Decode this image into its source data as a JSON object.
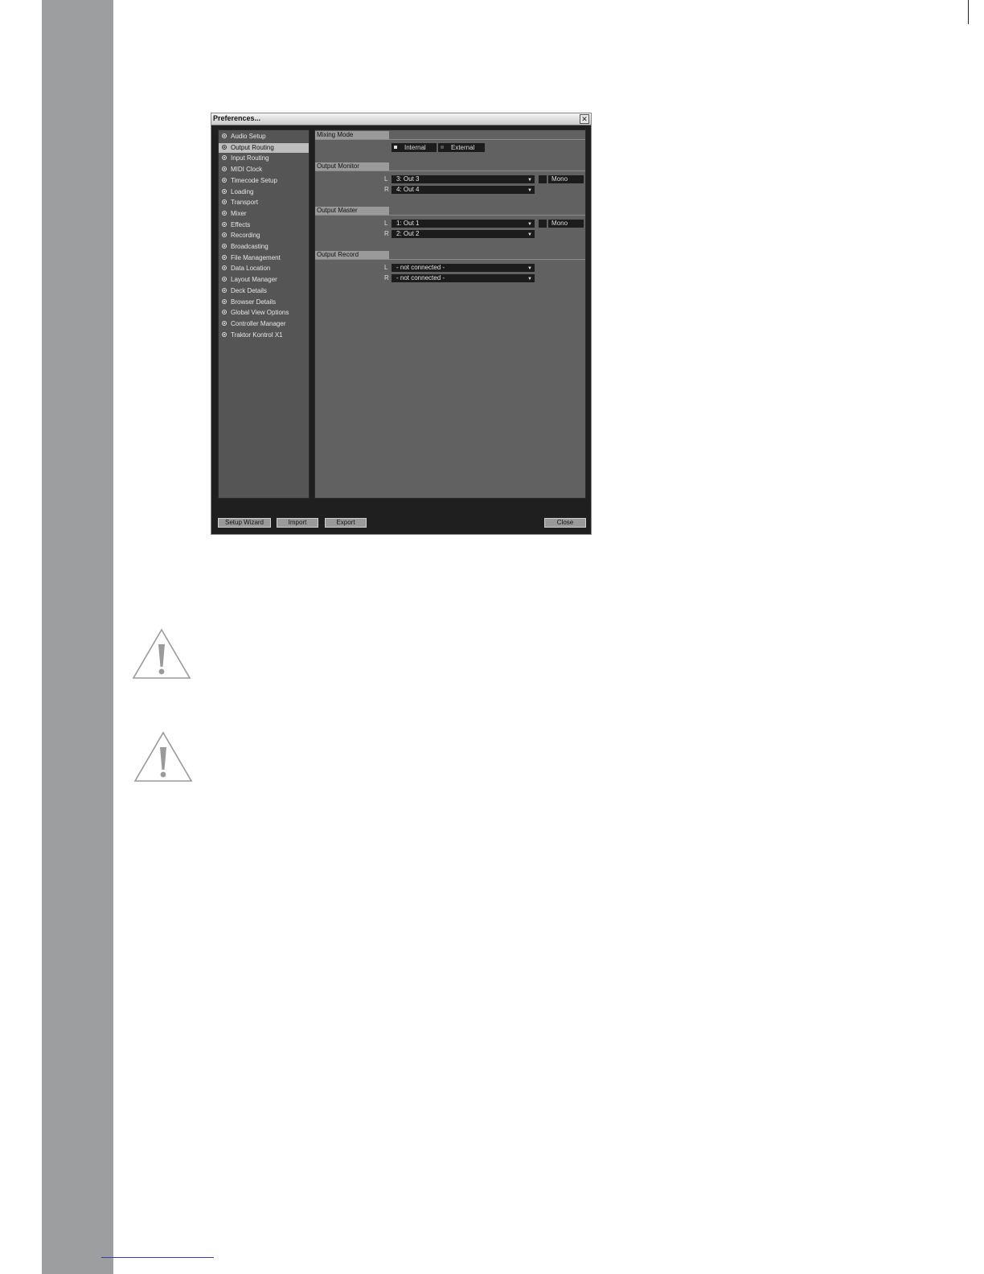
{
  "window": {
    "title": "Preferences...",
    "close_glyph": "✕"
  },
  "sidebar": {
    "items": [
      {
        "label": "Audio Setup",
        "selected": false
      },
      {
        "label": "Output Routing",
        "selected": true
      },
      {
        "label": "Input Routing",
        "selected": false
      },
      {
        "label": "MIDI Clock",
        "selected": false
      },
      {
        "label": "Timecode Setup",
        "selected": false
      },
      {
        "label": "Loading",
        "selected": false
      },
      {
        "label": "Transport",
        "selected": false
      },
      {
        "label": "Mixer",
        "selected": false
      },
      {
        "label": "Effects",
        "selected": false
      },
      {
        "label": "Recording",
        "selected": false
      },
      {
        "label": "Broadcasting",
        "selected": false
      },
      {
        "label": "File Management",
        "selected": false
      },
      {
        "label": "Data Location",
        "selected": false
      },
      {
        "label": "Layout Manager",
        "selected": false
      },
      {
        "label": "Deck Details",
        "selected": false
      },
      {
        "label": "Browser Details",
        "selected": false
      },
      {
        "label": "Global View Options",
        "selected": false
      },
      {
        "label": "Controller Manager",
        "selected": false
      },
      {
        "label": "Traktor Kontrol X1",
        "selected": false
      }
    ]
  },
  "mixing_mode": {
    "heading": "Mixing Mode",
    "internal_label": "Internal",
    "external_label": "External",
    "selected": "Internal"
  },
  "output_monitor": {
    "heading": "Output Monitor",
    "left_channel": "L",
    "right_channel": "R",
    "left_value": "3: Out 3",
    "right_value": "4: Out 4",
    "mono_label": "Mono"
  },
  "output_master": {
    "heading": "Output Master",
    "left_channel": "L",
    "right_channel": "R",
    "left_value": "1: Out 1",
    "right_value": "2: Out 2",
    "mono_label": "Mono"
  },
  "output_record": {
    "heading": "Output Record",
    "left_channel": "L",
    "right_channel": "R",
    "left_value": "- not connected -",
    "right_value": "- not connected -"
  },
  "buttons": {
    "setup_wizard": "Setup Wizard",
    "import": "Import",
    "export": "Export",
    "close": "Close"
  },
  "icons": {
    "dropdown": "▼",
    "warning": "warning-triangle-icon"
  },
  "colors": {
    "left_bar": "#9d9e9f",
    "window_bg": "#1f1f1f",
    "panel_bg": "#616161",
    "sidebar_bg": "#555555",
    "selected_item": "#bdbdbd"
  }
}
